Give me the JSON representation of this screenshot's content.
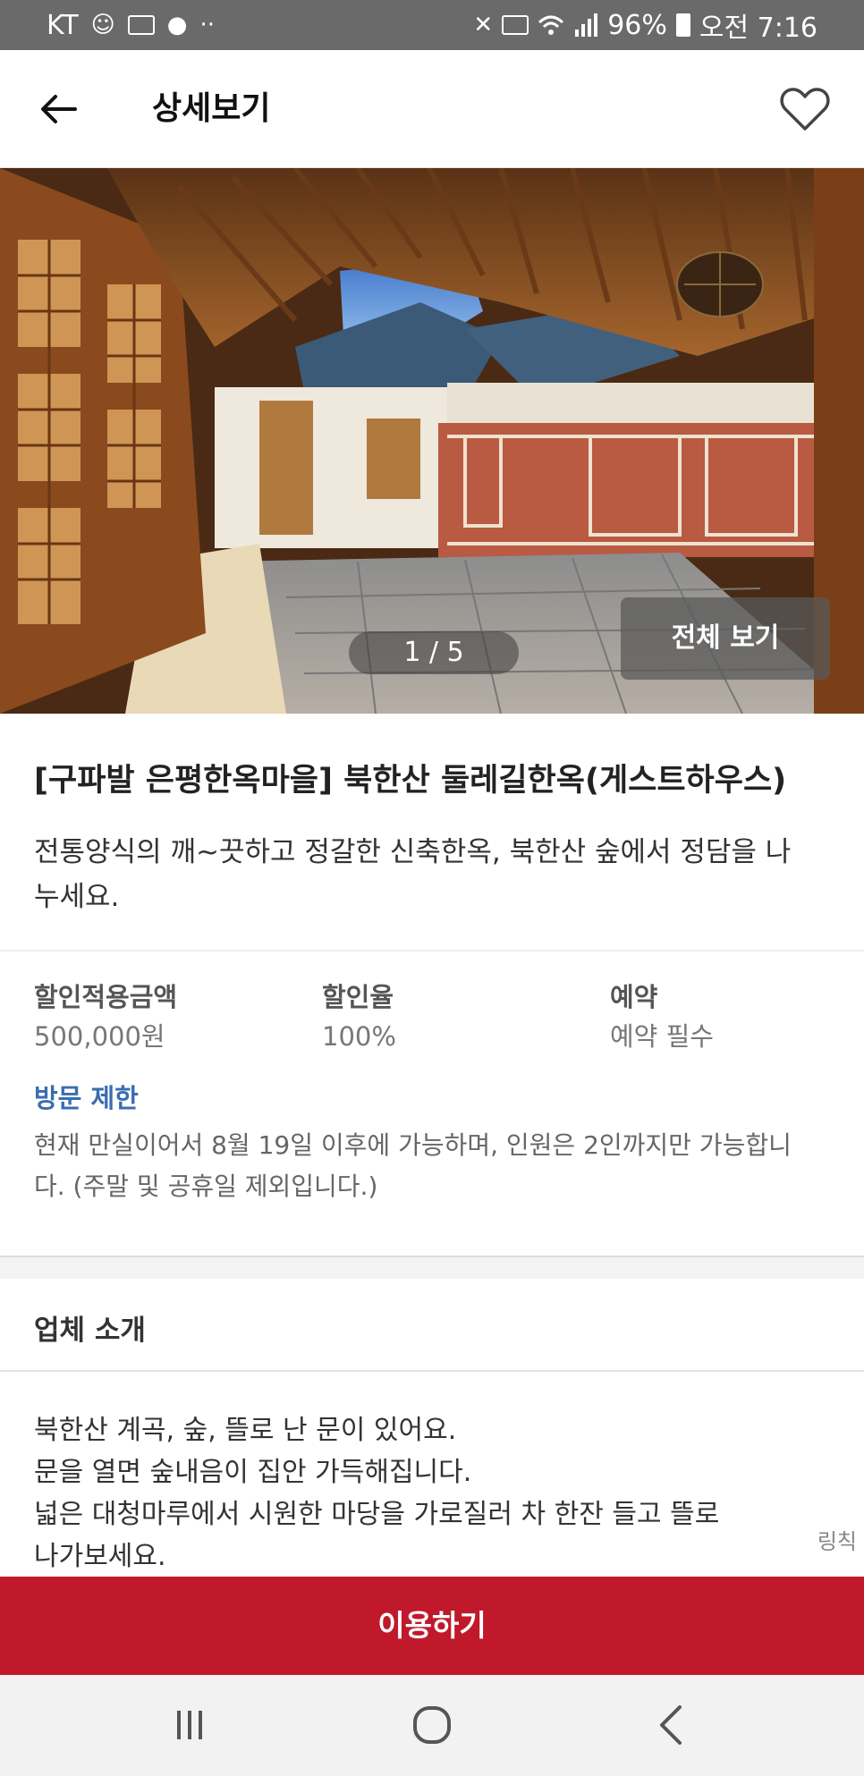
{
  "status_bar": {
    "carrier": "KT",
    "battery": "96%",
    "time": "오전 7:16",
    "icons": [
      "kakao-icon",
      "payco-icon",
      "notification-icon",
      "more-icon",
      "mute-icon",
      "hd-icon",
      "wifi-icon",
      "signal-icon",
      "battery-icon"
    ]
  },
  "header": {
    "title": "상세보기",
    "back_icon": "arrow-left-icon",
    "favorite_icon": "heart-outline-icon"
  },
  "gallery": {
    "counter": "1 / 5",
    "current": 1,
    "total": 5,
    "view_all_label": "전체 보기"
  },
  "listing": {
    "title": "[구파발 은평한옥마을] 북한산 둘레길한옥(게스트하우스)",
    "subtitle": "전통양식의 깨~끗하고 정갈한 신축한옥, 북한산 숲에서 정담을 나누세요."
  },
  "info": [
    {
      "label": "할인적용금액",
      "value": "500,000원"
    },
    {
      "label": "할인율",
      "value": "100%"
    },
    {
      "label": "예약",
      "value": "예약 필수"
    }
  ],
  "visit_limit": {
    "title": "방문 제한",
    "text": "현재 만실이어서 8월 19일 이후에 가능하며, 인원은 2인까지만 가능합니다. (주말 및 공휴일 제외입니다.)"
  },
  "intro": {
    "title": "업체 소개",
    "lines": [
      "북한산 계곡, 숲, 뜰로 난 문이 있어요.",
      "문을 열면 숲내음이 집안 가득해집니다.",
      "넓은 대청마루에서 시원한 마당을 가로질러 차 한잔 들고 뜰로",
      "나가보세요."
    ],
    "side_link": "링칙"
  },
  "action": {
    "use_label": "이용하기"
  },
  "colors": {
    "status_bar": "#6a6a6a",
    "accent_red": "#c0192c",
    "link_blue": "#3a6db0"
  }
}
